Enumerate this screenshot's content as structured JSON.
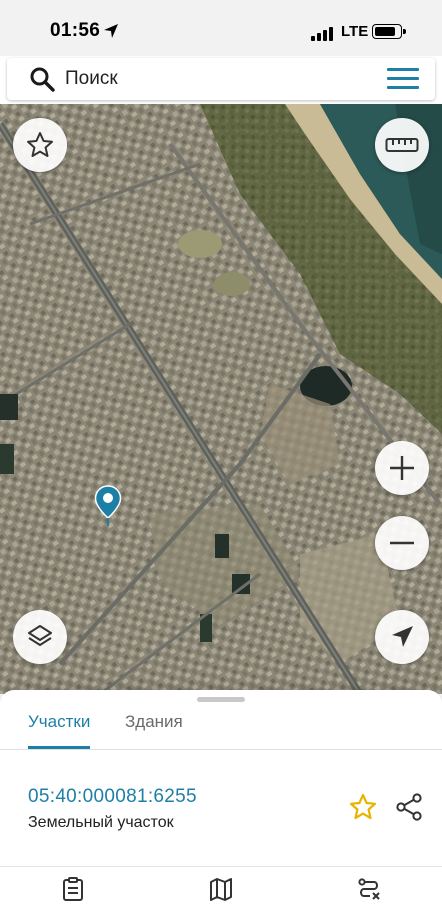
{
  "status_bar": {
    "time": "01:56",
    "network": "LTE",
    "battery_level": 0.85
  },
  "search": {
    "placeholder": "Поиск",
    "icon": "search-icon",
    "menu_icon": "menu-icon"
  },
  "map": {
    "controls": {
      "favorite": "star-icon",
      "ruler": "ruler-icon",
      "zoom_in": "plus-icon",
      "zoom_out": "minus-icon",
      "layers": "layers-icon",
      "locate": "navigation-arrow-icon"
    },
    "marker": "location-pin-icon",
    "colors": {
      "water": "#2c5a58",
      "urban": "#8a8574",
      "vegetation": "#4f5a2e",
      "road": "#6c6f68"
    }
  },
  "sheet": {
    "tabs": [
      {
        "label": "Участки",
        "active": true
      },
      {
        "label": "Здания",
        "active": false
      }
    ],
    "result": {
      "cadastral_number": "05:40:000081:6255",
      "object_type": "Земельный участок",
      "favorite_icon": "star-outline-icon",
      "share_icon": "share-icon"
    }
  },
  "bottom_nav": {
    "items": [
      {
        "icon": "clipboard-icon"
      },
      {
        "icon": "map-icon"
      },
      {
        "icon": "route-icon"
      }
    ]
  },
  "theme": {
    "accent": "#1e7fa6",
    "star": "#e8b400"
  }
}
